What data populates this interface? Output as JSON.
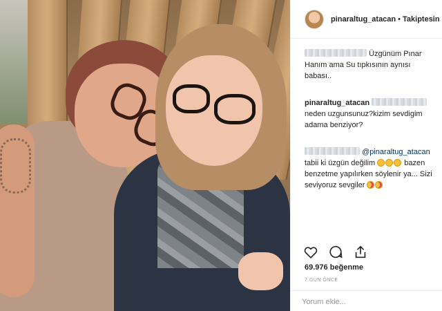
{
  "post": {
    "username": "pinaraltug_atacan",
    "separator": "•",
    "follow_state": "Takiptesin"
  },
  "comments": [
    {
      "username": "",
      "username_hidden": true,
      "text": "Üzgünüm Pınar Hanım ama Su tıpkısının aynısı babası.."
    },
    {
      "username": "pinaraltug_atacan",
      "mention_hidden": true,
      "text": "neden uzgunsunuz?kizim sevdigim adama benziyor?"
    },
    {
      "username": "",
      "username_hidden": true,
      "mention": "@pinaraltug_atacan",
      "text_part1": "tabii ki üzgün değilim",
      "text_part2": "bazen benzetme yapılırken söylenir ya... Sizi seviyoruz sevgiler"
    }
  ],
  "icons": {
    "like": "heart-outline-icon",
    "comment": "comment-bubble-icon",
    "share": "share-icon"
  },
  "likes": {
    "count": "69.976",
    "label": "beğenme"
  },
  "timestamp": "7 GÜN ÖNCE",
  "add_comment": {
    "placeholder": "Yorum ekle..."
  }
}
